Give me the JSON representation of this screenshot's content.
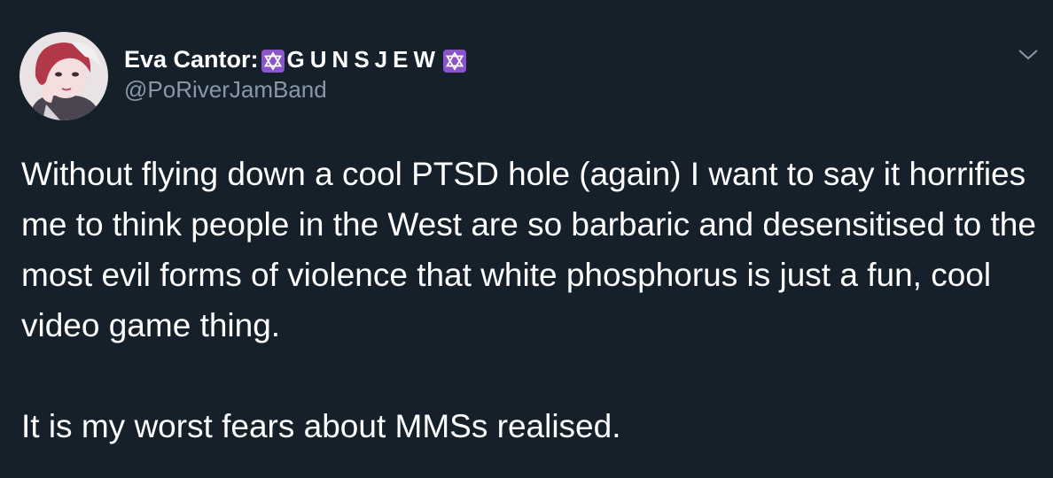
{
  "author": {
    "display_name": "Eva Cantor: ",
    "name_suffix": "GUNSJEW",
    "handle": "@PoRiverJamBand",
    "avatar_icon": "illustrated-portrait-avatar",
    "badge_icon": "star-of-david-icon",
    "badge_color": "#8a55c8"
  },
  "tweet": {
    "paragraphs": [
      "Without flying down a cool PTSD hole (again) I want to say it horrifies me to think people in the West are so barbaric and desensitised to the most evil forms of violence that white phosphorus is just a fun, cool video game thing.",
      "It is my worst fears about MMSs realised."
    ]
  },
  "menu": {
    "icon": "chevron-down-icon"
  },
  "theme": {
    "background": "#15202b",
    "text": "#ffffff",
    "secondary_text": "#8899a6"
  }
}
